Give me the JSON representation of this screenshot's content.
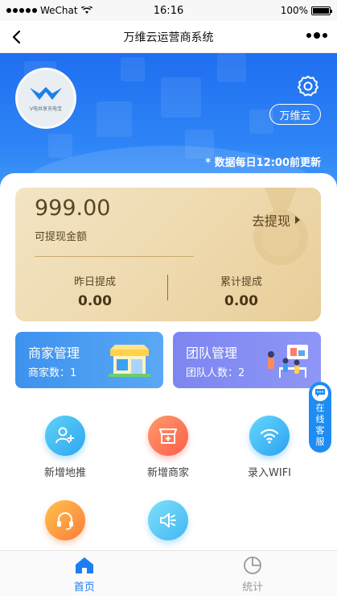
{
  "status_bar": {
    "carrier": "WeChat",
    "time": "16:16",
    "battery": "100%"
  },
  "nav": {
    "title": "万维云运营商系统"
  },
  "header": {
    "logo_text": "V电共享充电宝",
    "merchant_button": "万维云",
    "update_note": "* 数据每日12:00前更新"
  },
  "wallet": {
    "amount": "999.00",
    "amount_label": "可提现金额",
    "withdraw_label": "去提现",
    "yesterday_label": "昨日提成",
    "yesterday_value": "0.00",
    "total_label": "累计提成",
    "total_value": "0.00"
  },
  "cards": {
    "merchant": {
      "title": "商家管理",
      "sub": "商家数：1"
    },
    "team": {
      "title": "团队管理",
      "sub": "团队人数：2"
    }
  },
  "customer_service": {
    "label": [
      "在",
      "线",
      "客",
      "服"
    ]
  },
  "grid": [
    {
      "label": "新增地推",
      "icon": "add-user-icon"
    },
    {
      "label": "新增商家",
      "icon": "add-store-icon"
    },
    {
      "label": "录入WIFI",
      "icon": "wifi-icon"
    },
    {
      "label": "",
      "icon": "headset-icon"
    },
    {
      "label": "",
      "icon": "speaker-icon"
    }
  ],
  "tabbar": [
    {
      "label": "首页",
      "icon": "home-icon",
      "active": true
    },
    {
      "label": "统计",
      "icon": "pie-chart-icon",
      "active": false
    }
  ],
  "colors": {
    "primary": "#1f6ef0",
    "tab_active": "#1c7ef2",
    "gold": "#eed9ad"
  }
}
